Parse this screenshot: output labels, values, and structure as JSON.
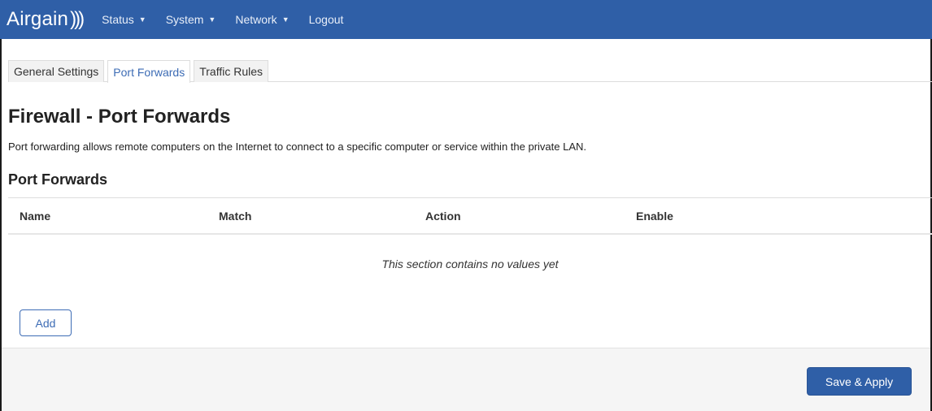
{
  "navbar": {
    "brand": "Airgain",
    "brand_mark": ")))",
    "menus": [
      {
        "label": "Status",
        "caret": "▼"
      },
      {
        "label": "System",
        "caret": "▼"
      },
      {
        "label": "Network",
        "caret": "▼"
      }
    ],
    "logout": "Logout"
  },
  "tabs": [
    {
      "label": "General Settings",
      "active": false
    },
    {
      "label": "Port Forwards",
      "active": true
    },
    {
      "label": "Traffic Rules",
      "active": false
    }
  ],
  "page": {
    "title": "Firewall - Port Forwards",
    "description": "Port forwarding allows remote computers on the Internet to connect to a specific computer or service within the private LAN."
  },
  "section": {
    "title": "Port Forwards",
    "columns": [
      "Name",
      "Match",
      "Action",
      "Enable"
    ],
    "empty_message": "This section contains no values yet",
    "add_label": "Add"
  },
  "footer": {
    "save_apply_label": "Save & Apply"
  },
  "colors": {
    "navbar": "#2f5fa7",
    "accent": "#3d6cb5",
    "footer_bg": "#f5f5f5"
  }
}
